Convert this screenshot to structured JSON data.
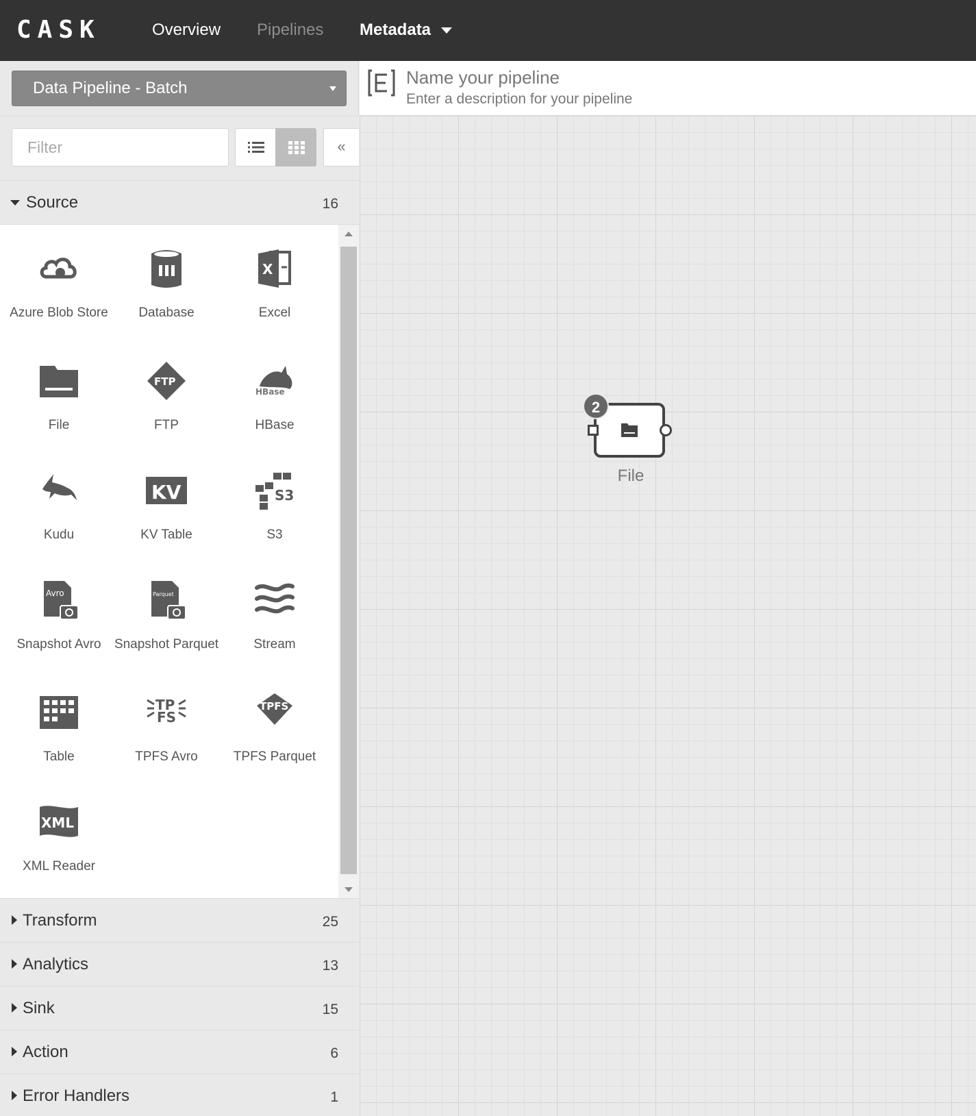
{
  "nav": {
    "logo": "CASK",
    "items": [
      {
        "label": "Overview"
      },
      {
        "label": "Pipelines"
      },
      {
        "label": "Metadata"
      }
    ]
  },
  "sidebar": {
    "pipeline_type": "Data Pipeline - Batch",
    "filter_placeholder": "Filter",
    "collapse_label": "«",
    "groups": [
      {
        "label": "Source",
        "count": "16"
      },
      {
        "label": "Transform",
        "count": "25"
      },
      {
        "label": "Analytics",
        "count": "13"
      },
      {
        "label": "Sink",
        "count": "15"
      },
      {
        "label": "Action",
        "count": "6"
      },
      {
        "label": "Error Handlers",
        "count": "1"
      }
    ],
    "plugins": [
      {
        "label": "Azure Blob Store",
        "icon": "azure-cloud-icon"
      },
      {
        "label": "Database",
        "icon": "database-icon"
      },
      {
        "label": "Excel",
        "icon": "excel-icon"
      },
      {
        "label": "File",
        "icon": "folder-icon"
      },
      {
        "label": "FTP",
        "icon": "ftp-icon"
      },
      {
        "label": "HBase",
        "icon": "hbase-icon"
      },
      {
        "label": "Kudu",
        "icon": "kudu-icon"
      },
      {
        "label": "KV Table",
        "icon": "kv-icon"
      },
      {
        "label": "S3",
        "icon": "s3-icon"
      },
      {
        "label": "Snapshot Avro",
        "icon": "snapshot-avro-icon"
      },
      {
        "label": "Snapshot Parquet",
        "icon": "snapshot-parquet-icon"
      },
      {
        "label": "Stream",
        "icon": "stream-icon"
      },
      {
        "label": "Table",
        "icon": "table-icon"
      },
      {
        "label": "TPFS Avro",
        "icon": "tpfs-avro-icon"
      },
      {
        "label": "TPFS Parquet",
        "icon": "tpfs-parquet-icon"
      },
      {
        "label": "XML Reader",
        "icon": "xml-icon"
      }
    ]
  },
  "header": {
    "name_placeholder": "Name your pipeline",
    "description_placeholder": "Enter a description for your pipeline"
  },
  "canvas": {
    "node": {
      "label": "File",
      "badge": "2",
      "icon": "folder-icon"
    }
  },
  "icon_texts": {
    "excel": "X",
    "ftp": "FTP",
    "hbase": "HBase",
    "kv": "KV",
    "s3": "S3",
    "avro": "Avro",
    "parquet": "Parquet",
    "tpfs_avro_1": "TP",
    "tpfs_avro_2": "FS",
    "tpfs_parquet": "TPFS",
    "xml": "XML"
  },
  "colors": {
    "topbar": "#333333",
    "icon": "#5a5a5a",
    "canvas": "#eaeaea"
  }
}
